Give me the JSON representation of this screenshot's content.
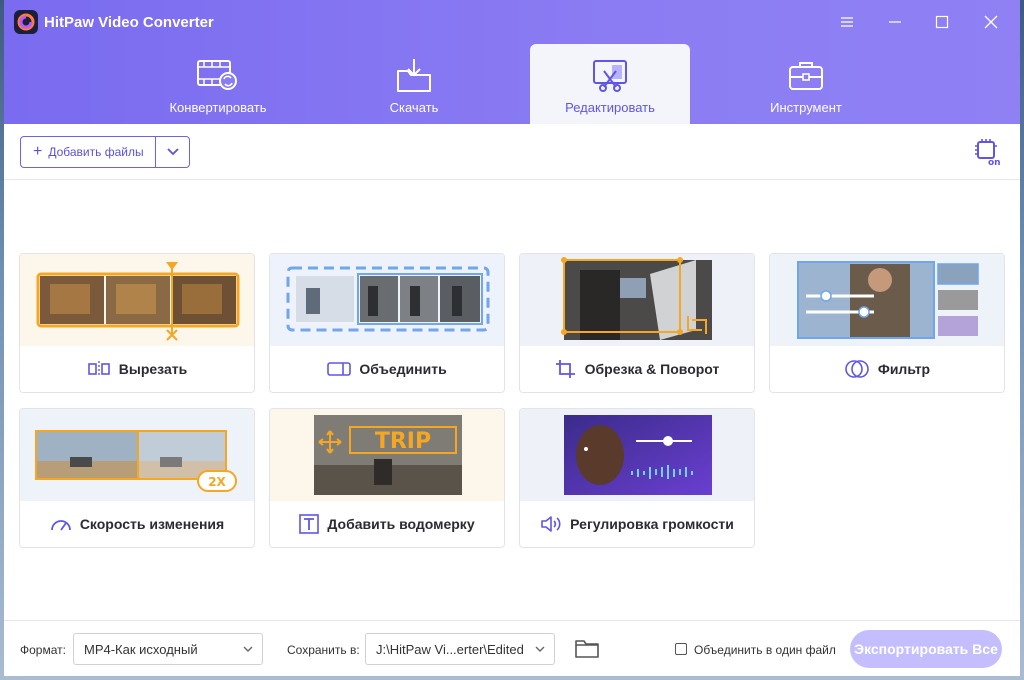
{
  "app": {
    "title": "HitPaw Video Converter"
  },
  "tabs": [
    {
      "label": "Конвертировать",
      "icon": "film-convert-icon"
    },
    {
      "label": "Скачать",
      "icon": "download-folder-icon"
    },
    {
      "label": "Редактировать",
      "icon": "edit-scissors-icon",
      "active": true
    },
    {
      "label": "Инструмент",
      "icon": "toolbox-icon"
    }
  ],
  "toolbar": {
    "add_files_label": "Добавить файлы"
  },
  "cards": [
    {
      "label": "Вырезать",
      "icon": "cut-icon"
    },
    {
      "label": "Объединить",
      "icon": "merge-icon"
    },
    {
      "label": "Обрезка & Поворот",
      "icon": "crop-icon"
    },
    {
      "label": "Фильтр",
      "icon": "filter-icon"
    },
    {
      "label": "Скорость изменения",
      "icon": "speed-icon",
      "badge": "2X"
    },
    {
      "label": "Добавить водомерку",
      "icon": "watermark-text-icon",
      "watermark_text": "TRIP"
    },
    {
      "label": "Регулировка громкости",
      "icon": "volume-icon"
    }
  ],
  "bottom": {
    "format_label": "Формат:",
    "format_value": "MP4-Как исходный",
    "save_label": "Сохранить в:",
    "save_value": "J:\\HitPaw Vi...erter\\Edited",
    "merge_label": "Объединить в один файл",
    "export_label": "Экспортировать Все"
  },
  "colors": {
    "accent": "#7a6bf0",
    "active_tab_text": "#5f56e8",
    "export_disabled": "#c4beff",
    "highlight": "#f5a623"
  }
}
